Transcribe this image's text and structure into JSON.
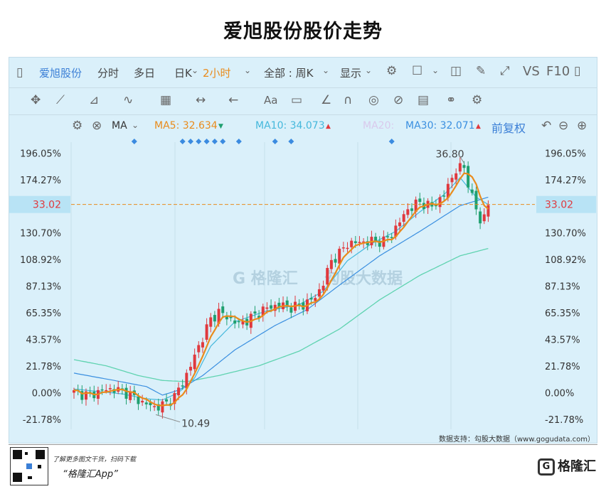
{
  "title": "爱旭股份股价走势",
  "toolbar": {
    "stock_name": "爱旭股份",
    "fenshi": "分时",
    "duori": "多日",
    "rik": "日K",
    "period": "2小时",
    "range": "全部 : 周K",
    "display": "显示",
    "vs": "VS",
    "f10": "F10",
    "aa": "Aa"
  },
  "ma_bar": {
    "ma": "MA",
    "ma5": "MA5: 32.634",
    "ma10": "MA10: 34.073",
    "ma20": "MA20:",
    "ma30": "MA30: 32.071",
    "adjust": "前复权"
  },
  "colors": {
    "up": "#e0393e",
    "down": "#20a070",
    "ma5": "#e98b1c",
    "ma10": "#45b8dc",
    "ma20": "#3a8fe0",
    "ma30": "#5fd3b0",
    "price_line": "#e98b1c"
  },
  "chart_data": {
    "type": "candlestick",
    "y_ticks": [
      "196.05%",
      "174.27%",
      "152.49%",
      "130.70%",
      "108.92%",
      "87.13%",
      "65.35%",
      "43.57%",
      "21.78%",
      "0.00%",
      "-21.78%"
    ],
    "y_tick_values": [
      196.05,
      174.27,
      152.49,
      130.7,
      108.92,
      87.13,
      65.35,
      43.57,
      21.78,
      0,
      -21.78
    ],
    "ylim": [
      -30,
      205
    ],
    "current_price": "33.02",
    "current_pct": 154,
    "high_label": "36.80",
    "low_label": "10.49",
    "candle_count": 110,
    "anchors_pct": [
      [
        0,
        0
      ],
      [
        4,
        -2
      ],
      [
        7,
        2
      ],
      [
        10,
        3
      ],
      [
        13,
        0
      ],
      [
        17,
        -8
      ],
      [
        20,
        -12
      ],
      [
        23,
        -9
      ],
      [
        25,
        -3
      ],
      [
        27,
        8
      ],
      [
        29,
        22
      ],
      [
        31,
        38
      ],
      [
        34,
        60
      ],
      [
        36,
        66
      ],
      [
        39,
        60
      ],
      [
        41,
        56
      ],
      [
        44,
        61
      ],
      [
        47,
        68
      ],
      [
        51,
        72
      ],
      [
        54,
        70
      ],
      [
        57,
        72
      ],
      [
        60,
        78
      ],
      [
        62,
        90
      ],
      [
        64,
        108
      ],
      [
        66,
        114
      ],
      [
        68,
        122
      ],
      [
        71,
        123
      ],
      [
        74,
        124
      ],
      [
        77,
        124
      ],
      [
        79,
        130
      ],
      [
        81,
        140
      ],
      [
        83,
        150
      ],
      [
        86,
        156
      ],
      [
        89,
        152
      ],
      [
        92,
        162
      ],
      [
        95,
        183
      ],
      [
        97,
        184
      ],
      [
        99,
        160
      ],
      [
        101,
        140
      ],
      [
        102,
        145
      ],
      [
        103,
        155
      ]
    ],
    "ma10_anchors_pct": [
      [
        0,
        3
      ],
      [
        6,
        1
      ],
      [
        12,
        -1
      ],
      [
        18,
        -5
      ],
      [
        22,
        -6
      ],
      [
        26,
        0
      ],
      [
        30,
        12
      ],
      [
        34,
        38
      ],
      [
        40,
        58
      ],
      [
        48,
        67
      ],
      [
        56,
        72
      ],
      [
        62,
        83
      ],
      [
        68,
        108
      ],
      [
        74,
        122
      ],
      [
        80,
        132
      ],
      [
        86,
        148
      ],
      [
        92,
        162
      ],
      [
        96,
        176
      ],
      [
        100,
        160
      ],
      [
        103,
        154
      ]
    ],
    "ma20_anchors_pct": [
      [
        0,
        16
      ],
      [
        10,
        10
      ],
      [
        18,
        5
      ],
      [
        22,
        -2
      ],
      [
        26,
        2
      ],
      [
        32,
        14
      ],
      [
        40,
        35
      ],
      [
        50,
        55
      ],
      [
        58,
        68
      ],
      [
        66,
        88
      ],
      [
        76,
        112
      ],
      [
        86,
        132
      ],
      [
        96,
        153
      ],
      [
        103,
        160
      ]
    ],
    "ma30_anchors_pct": [
      [
        0,
        27
      ],
      [
        8,
        22
      ],
      [
        16,
        14
      ],
      [
        22,
        10
      ],
      [
        28,
        9
      ],
      [
        36,
        14
      ],
      [
        46,
        22
      ],
      [
        56,
        34
      ],
      [
        66,
        52
      ],
      [
        76,
        76
      ],
      [
        86,
        96
      ],
      [
        96,
        112
      ],
      [
        103,
        118
      ]
    ],
    "markers_x": [
      15,
      27,
      29,
      31,
      33,
      35,
      37,
      41,
      50,
      54,
      79
    ]
  }
}
